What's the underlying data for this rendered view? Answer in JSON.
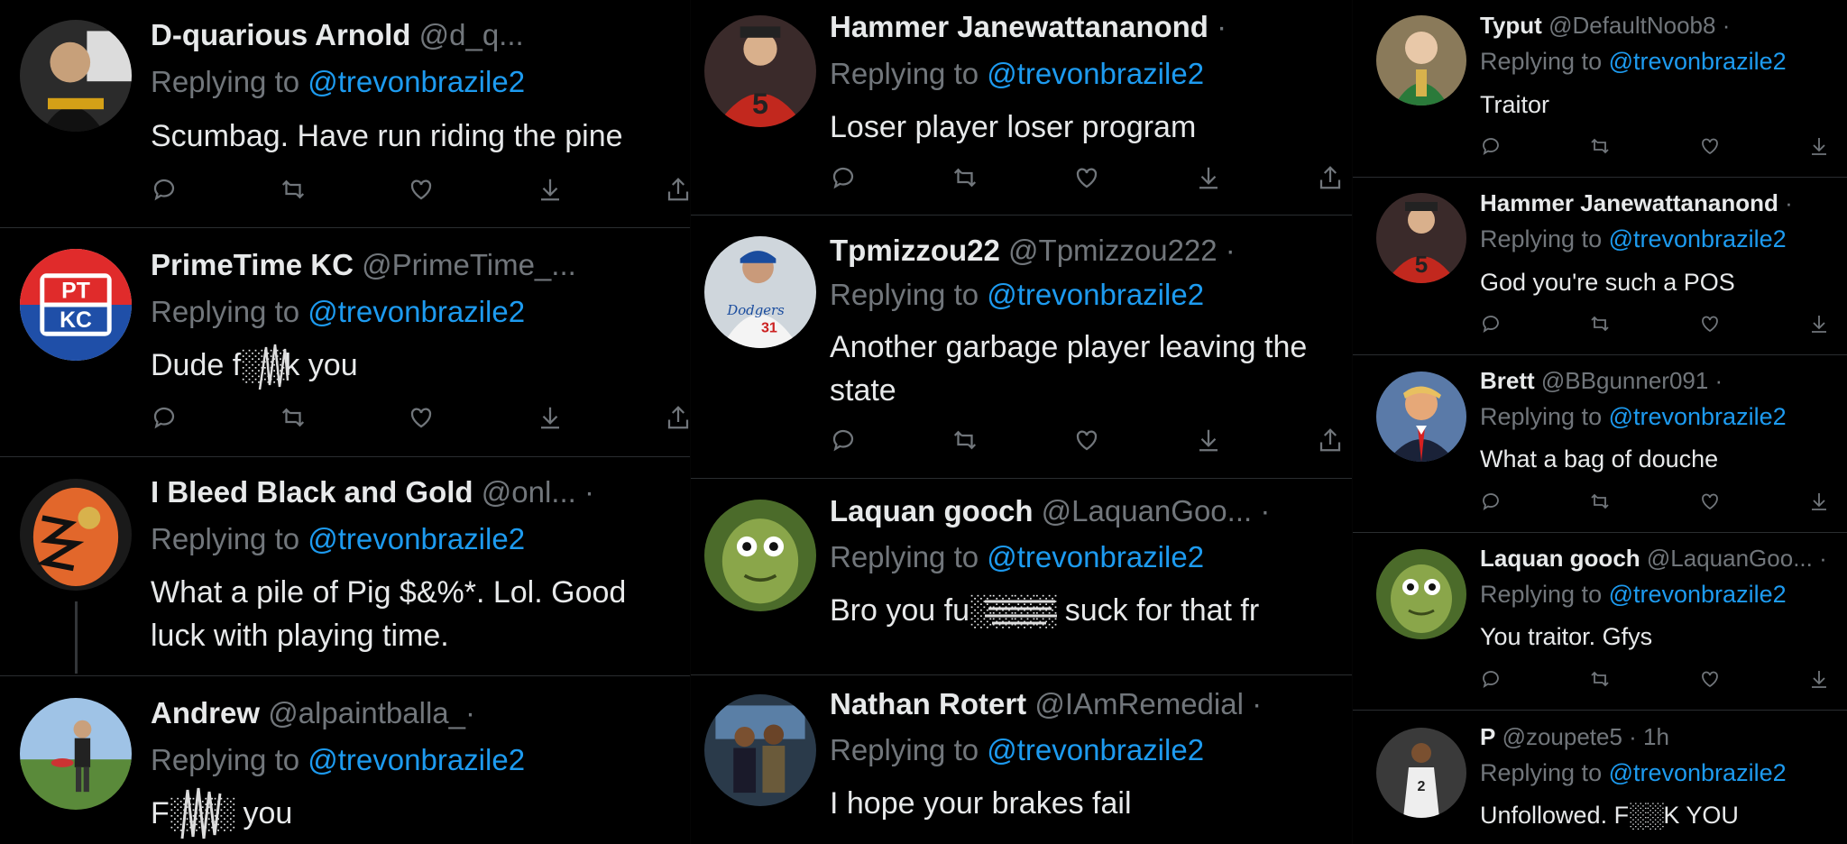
{
  "col1": [
    {
      "name": "D-quarious Arnold",
      "handle": "@d_q...",
      "reply_prefix": "Replying to ",
      "mention": "@trevonbrazile2",
      "text": "Scumbag. Have run riding the pine"
    },
    {
      "name": "PrimeTime KC",
      "handle": "@PrimeTime_...",
      "reply_prefix": "Replying to ",
      "mention": "@trevonbrazile2",
      "text": "Dude f░░k you",
      "avatar_text": [
        "PT",
        "KC"
      ]
    },
    {
      "name": "I Bleed Black and Gold",
      "handle": "@onl... ·",
      "reply_prefix": "Replying to ",
      "mention": "@trevonbrazile2",
      "text": "What a pile of Pig $&%*. Lol. Good luck with playing time."
    },
    {
      "name": "Andrew",
      "handle": "@alpaintballa_·",
      "reply_prefix": "Replying to ",
      "mention": "@trevonbrazile2",
      "text": "F░░░ you"
    }
  ],
  "col2": [
    {
      "name": "Hammer Janewattananond",
      "handle": "·",
      "reply_prefix": "Replying to ",
      "mention": "@trevonbrazile2",
      "text": "Loser player loser program"
    },
    {
      "name": "Tpmizzou22",
      "handle": "@Tpmizzou222 ·",
      "reply_prefix": "Replying to ",
      "mention": "@trevonbrazile2",
      "text": "Another garbage player leaving the state"
    },
    {
      "name": "Laquan gooch",
      "handle": "@LaquanGoo... ·",
      "reply_prefix": "Replying to ",
      "mention": "@trevonbrazile2",
      "text": "Bro you fu░░░░ suck for that fr"
    },
    {
      "name": "Nathan Rotert",
      "handle": "@IAmRemedial ·",
      "reply_prefix": "Replying to ",
      "mention": "@trevonbrazile2",
      "text": "I hope your brakes fail"
    }
  ],
  "col3": [
    {
      "name": "Typut",
      "handle": "@DefaultNoob8 ·",
      "reply_prefix": "Replying to ",
      "mention": "@trevonbrazile2",
      "text": "Traitor"
    },
    {
      "name": "Hammer Janewattananond",
      "handle": "·",
      "reply_prefix": "Replying to ",
      "mention": "@trevonbrazile2",
      "text": "God you're such a POS"
    },
    {
      "name": "Brett",
      "handle": "@BBgunner091 ·",
      "reply_prefix": "Replying to ",
      "mention": "@trevonbrazile2",
      "text": "What a bag of douche"
    },
    {
      "name": "Laquan gooch",
      "handle": "@LaquanGoo... ·",
      "reply_prefix": "Replying to ",
      "mention": "@trevonbrazile2",
      "text": "You traitor. Gfys"
    },
    {
      "name": "P",
      "handle": "@zoupete5 · 1h",
      "reply_prefix": "Replying to ",
      "mention": "@trevonbrazile2",
      "text": "Unfollowed. F░░K YOU"
    }
  ],
  "icons": [
    "reply-icon",
    "retweet-icon",
    "like-icon",
    "download-icon",
    "share-icon"
  ],
  "colors": {
    "background": "#000000",
    "text": "#e7e9ea",
    "muted": "#71767b",
    "mention": "#1d9bf0",
    "divider": "#2a2d30"
  }
}
